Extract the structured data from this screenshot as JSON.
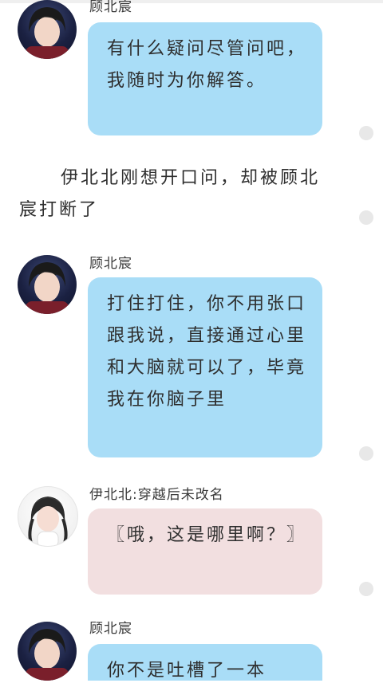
{
  "messages": [
    {
      "sender": "顾北宸",
      "text": "有什么疑问尽管问吧，我随时为你解答。"
    },
    {
      "narration": "伊北北刚想开口问，却被顾北宸打断了"
    },
    {
      "sender": "顾北宸",
      "text": "打住打住，你不用张口跟我说，直接通过心里和大脑就可以了，毕竟我在你脑子里"
    },
    {
      "sender": "伊北北:穿越后未改名",
      "text": "〖哦，这是哪里啊？〗"
    },
    {
      "sender": "顾北宸",
      "text": "你不是吐槽了一本"
    }
  ],
  "colors": {
    "bubble_blue": "#a9ddf7",
    "bubble_pink": "#f2dfe0",
    "dot": "#e8e8e8"
  }
}
